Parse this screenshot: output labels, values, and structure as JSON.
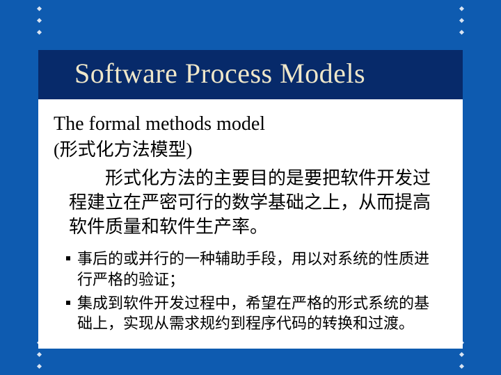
{
  "title": "Software Process Models",
  "subhead_en": "The formal methods model",
  "subhead_cn": "(形式化方法模型)",
  "paragraph": "形式化方法的主要目的是要把软件开发过程建立在严密可行的数学基础之上，从而提高软件质量和软件生产率。",
  "bullets": [
    "事后的或并行的一种辅助手段，用以对系统的性质进行严格的验证；",
    "集成到软件开发过程中，希望在严格的形式系统的基础上，实现从需求规约到程序代码的转换和过渡。"
  ]
}
